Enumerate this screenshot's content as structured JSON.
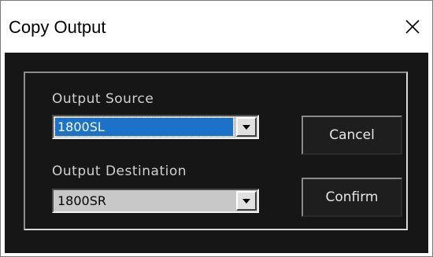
{
  "window": {
    "title": "Copy Output",
    "close_icon": "close-icon"
  },
  "form": {
    "source": {
      "label": "Output Source",
      "value": "1800SL",
      "arrow_icon": "dropdown-arrow-icon"
    },
    "destination": {
      "label": "Output Destination",
      "value": "1800SR",
      "arrow_icon": "dropdown-arrow-icon"
    }
  },
  "buttons": {
    "cancel": "Cancel",
    "confirm": "Confirm"
  },
  "colors": {
    "panel_bg": "#161616",
    "selection": "#1a73c8",
    "button_bg": "#1e1e1e",
    "combo_bg": "#c8c8c8"
  }
}
